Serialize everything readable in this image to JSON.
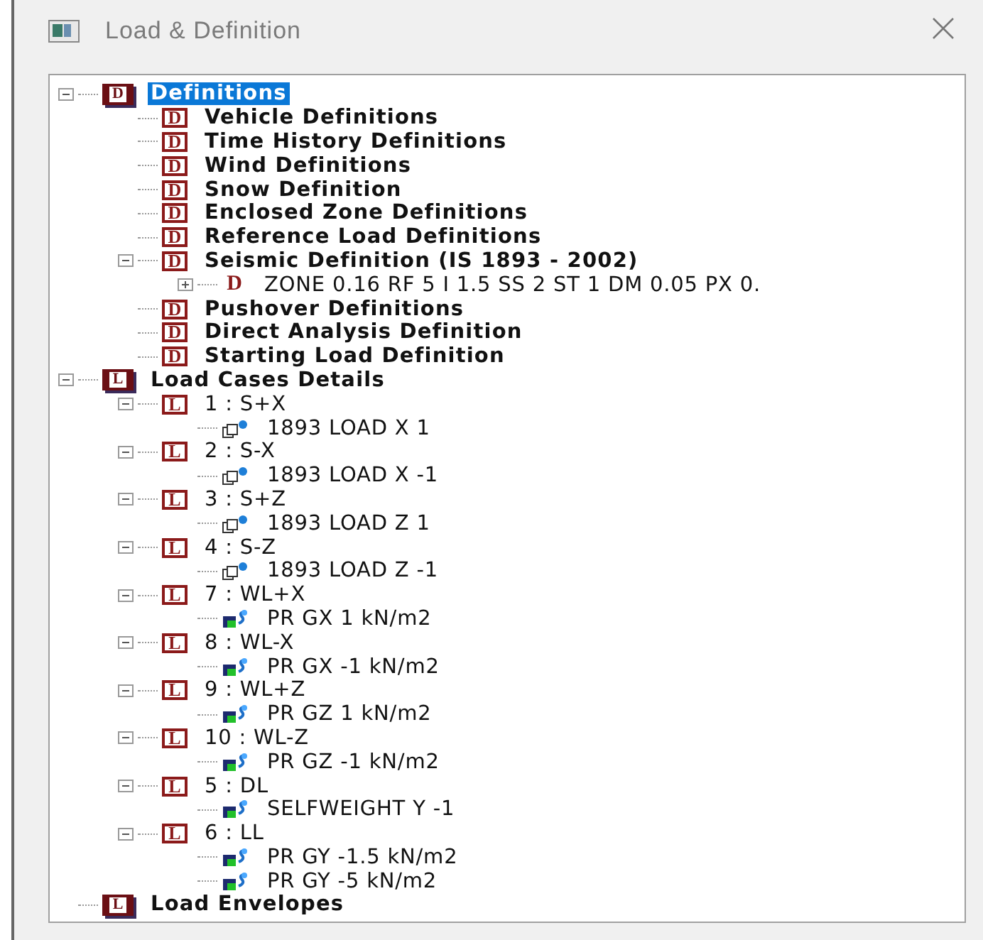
{
  "window": {
    "title": "Load & Definition"
  },
  "tree": [
    {
      "label": "Definitions",
      "badge": "D",
      "kind": "root",
      "selected": true,
      "expanded": true,
      "children": [
        {
          "label": "Vehicle Definitions",
          "badge": "D",
          "kind": "box",
          "selected": false
        },
        {
          "label": "Time History Definitions",
          "badge": "D",
          "kind": "box",
          "selected": false
        },
        {
          "label": "Wind Definitions",
          "badge": "D",
          "kind": "box",
          "selected": false
        },
        {
          "label": "Snow Definition",
          "badge": "D",
          "kind": "box",
          "selected": false
        },
        {
          "label": "Enclosed Zone Definitions",
          "badge": "D",
          "kind": "box",
          "selected": false
        },
        {
          "label": "Reference Load Definitions",
          "badge": "D",
          "kind": "box",
          "selected": false
        },
        {
          "label": "Seismic Definition (IS 1893 - 2002)",
          "badge": "D",
          "kind": "box",
          "selected": false,
          "expanded": true,
          "children": [
            {
              "label": "ZONE 0.16 RF 5 I 1.5 SS 2 ST 1 DM 0.05 PX 0.",
              "badge": "D",
              "kind": "plain",
              "selected": false,
              "expanded": false
            }
          ]
        },
        {
          "label": "Pushover Definitions",
          "badge": "D",
          "kind": "box",
          "selected": false
        },
        {
          "label": "Direct Analysis Definition",
          "badge": "D",
          "kind": "box",
          "selected": false
        },
        {
          "label": "Starting Load Definition",
          "badge": "D",
          "kind": "box",
          "selected": false
        }
      ]
    },
    {
      "label": "Load Cases Details",
      "badge": "L",
      "kind": "root",
      "selected": false,
      "expanded": true,
      "children": [
        {
          "label": "1 : S+X",
          "badge": "L",
          "kind": "case",
          "selected": false,
          "expanded": true,
          "children": [
            {
              "label": "1893 LOAD X 1",
              "kind": "seismic",
              "selected": false
            }
          ]
        },
        {
          "label": "2 : S-X",
          "badge": "L",
          "kind": "case",
          "selected": false,
          "expanded": true,
          "children": [
            {
              "label": "1893 LOAD X -1",
              "kind": "seismic",
              "selected": false
            }
          ]
        },
        {
          "label": "3 : S+Z",
          "badge": "L",
          "kind": "case",
          "selected": false,
          "expanded": true,
          "children": [
            {
              "label": "1893 LOAD Z 1",
              "kind": "seismic",
              "selected": false
            }
          ]
        },
        {
          "label": "4 : S-Z",
          "badge": "L",
          "kind": "case",
          "selected": false,
          "expanded": true,
          "children": [
            {
              "label": "1893 LOAD Z -1",
              "kind": "seismic",
              "selected": false
            }
          ]
        },
        {
          "label": "7 : WL+X",
          "badge": "L",
          "kind": "case",
          "selected": false,
          "expanded": true,
          "children": [
            {
              "label": "PR GX 1  kN/m2",
              "kind": "pressure",
              "selected": false
            }
          ]
        },
        {
          "label": "8 : WL-X",
          "badge": "L",
          "kind": "case",
          "selected": false,
          "expanded": true,
          "children": [
            {
              "label": "PR GX -1  kN/m2",
              "kind": "pressure",
              "selected": false
            }
          ]
        },
        {
          "label": "9 : WL+Z",
          "badge": "L",
          "kind": "case",
          "selected": false,
          "expanded": true,
          "children": [
            {
              "label": "PR GZ 1  kN/m2",
              "kind": "pressure",
              "selected": false
            }
          ]
        },
        {
          "label": "10 : WL-Z",
          "badge": "L",
          "kind": "case",
          "selected": false,
          "expanded": true,
          "children": [
            {
              "label": "PR GZ -1  kN/m2",
              "kind": "pressure",
              "selected": false
            }
          ]
        },
        {
          "label": "5 : DL",
          "badge": "L",
          "kind": "case",
          "selected": false,
          "expanded": true,
          "children": [
            {
              "label": "SELFWEIGHT Y -1",
              "kind": "pressure",
              "selected": false
            }
          ]
        },
        {
          "label": "6 : LL",
          "badge": "L",
          "kind": "case",
          "selected": false,
          "expanded": true,
          "children": [
            {
              "label": "PR GY -1.5  kN/m2",
              "kind": "pressure",
              "selected": false
            },
            {
              "label": "PR GY -5  kN/m2",
              "kind": "pressure",
              "selected": false
            }
          ]
        }
      ]
    },
    {
      "label": "Load Envelopes",
      "badge": "L",
      "kind": "root",
      "selected": false
    }
  ]
}
